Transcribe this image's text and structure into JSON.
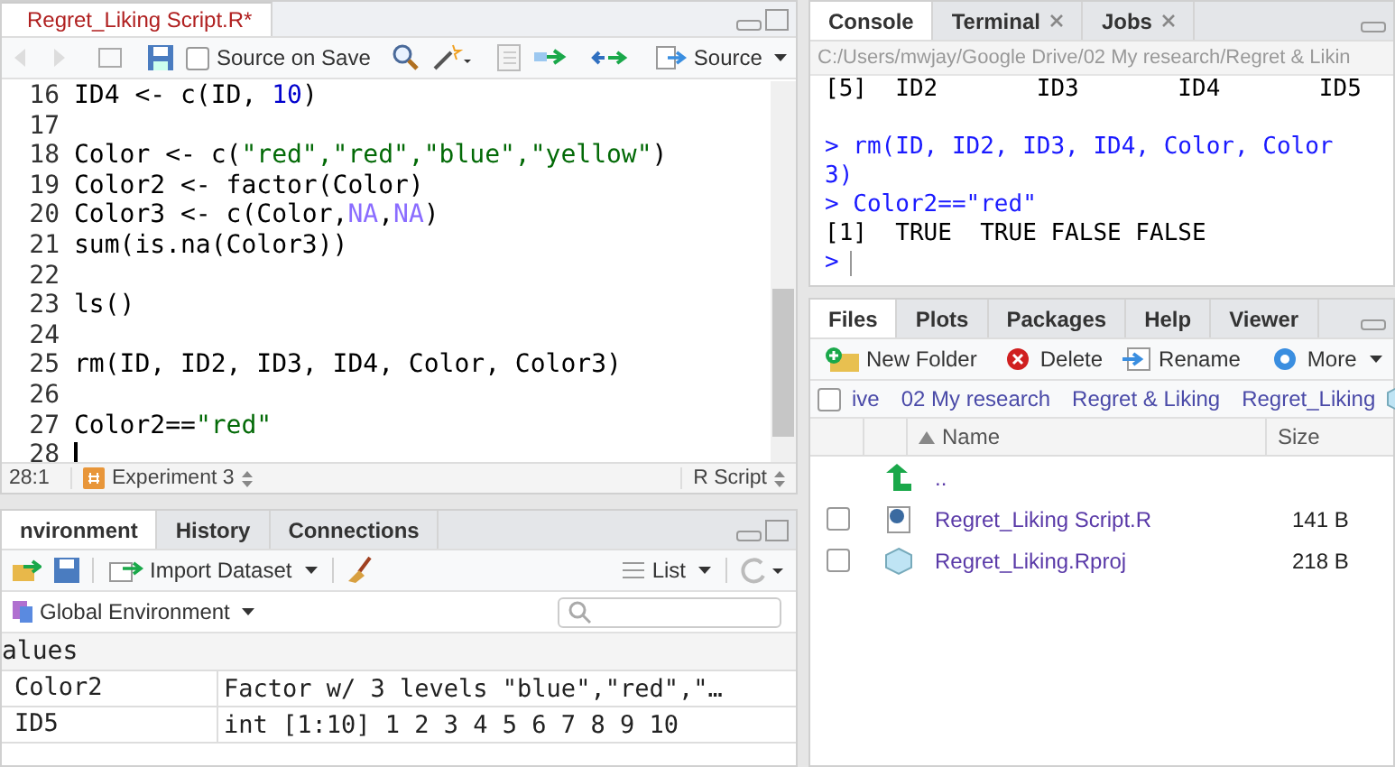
{
  "editor": {
    "tab": {
      "label": "Regret_Liking Script.R*",
      "selected": true
    },
    "toolbar": {
      "source_on_save": {
        "label": "Source on Save",
        "checked": false
      },
      "source_button": "Source"
    },
    "lines": [
      {
        "number": "16",
        "cursor": false,
        "tokens": [
          {
            "text": "ID4 <- c(ID, ",
            "kind": "plain"
          },
          {
            "text": "10",
            "kind": "number"
          },
          {
            "text": ")",
            "kind": "plain"
          }
        ]
      },
      {
        "number": "17",
        "cursor": false
      },
      {
        "number": "18",
        "cursor": false,
        "tokens": [
          {
            "text": "Color <- c(",
            "kind": "plain"
          },
          {
            "text": "\"red\",\"red\",\"blue\",\"yellow\"",
            "kind": "string"
          },
          {
            "text": ")",
            "kind": "plain"
          }
        ]
      },
      {
        "number": "19",
        "cursor": false,
        "tokens": [
          {
            "text": "Color2 <- factor(Color)",
            "kind": "plain"
          }
        ]
      },
      {
        "number": "20",
        "cursor": false,
        "tokens": [
          {
            "text": "Color3 <- c(Color,",
            "kind": "plain"
          },
          {
            "text": "NA",
            "kind": "constant"
          },
          {
            "text": ",",
            "kind": "plain"
          },
          {
            "text": "NA",
            "kind": "constant"
          },
          {
            "text": ")",
            "kind": "plain"
          }
        ]
      },
      {
        "number": "21",
        "cursor": false,
        "tokens": [
          {
            "text": "sum(is.na(Color3))",
            "kind": "plain"
          }
        ]
      },
      {
        "number": "22",
        "cursor": false
      },
      {
        "number": "23",
        "cursor": false,
        "tokens": [
          {
            "text": "ls()",
            "kind": "plain"
          }
        ]
      },
      {
        "number": "24",
        "cursor": false
      },
      {
        "number": "25",
        "cursor": false,
        "tokens": [
          {
            "text": "rm(ID, ID2, ID3, ID4, Color, Color3)",
            "kind": "plain"
          }
        ]
      },
      {
        "number": "26",
        "cursor": false
      },
      {
        "number": "27",
        "cursor": false,
        "tokens": [
          {
            "text": "Color2==",
            "kind": "plain"
          },
          {
            "text": "\"red\"",
            "kind": "string"
          }
        ]
      },
      {
        "number": "28",
        "cursor": true
      }
    ],
    "status": {
      "position": "28:1",
      "section": "Experiment 3",
      "file_type": "R Script"
    }
  },
  "console": {
    "tabs": [
      {
        "label": "Console",
        "selected": true,
        "closable": false
      },
      {
        "label": "Terminal",
        "selected": false,
        "closable": true
      },
      {
        "label": "Jobs",
        "selected": false,
        "closable": true
      }
    ],
    "path": "C:/Users/mwjay/Google Drive/02 My research/Regret & Likin",
    "lines": [
      {
        "kind": "output",
        "text": "[5]  ID2       ID3       ID4       ID5"
      },
      {
        "kind": "blank"
      },
      {
        "kind": "input",
        "text": "> rm(ID, ID2, ID3, ID4, Color, Color"
      },
      {
        "kind": "input",
        "text": "3)"
      },
      {
        "kind": "input",
        "text": "> Color2==\"red\""
      },
      {
        "kind": "output",
        "text": "[1]  TRUE  TRUE FALSE FALSE"
      },
      {
        "kind": "prompt",
        "text": ">"
      }
    ]
  },
  "environment": {
    "tabs": [
      {
        "label": "nvironment",
        "selected": true
      },
      {
        "label": "History",
        "selected": false
      },
      {
        "label": "Connections",
        "selected": false
      }
    ],
    "import_button": "Import Dataset",
    "view_button": "List",
    "scope": "Global Environment",
    "section": "alues",
    "rows": [
      {
        "name": "Color2",
        "value": "Factor w/ 3 levels \"blue\",\"red\",\"…"
      },
      {
        "name": "ID5",
        "value": "int [1:10] 1 2 3 4 5 6 7 8 9 10"
      }
    ]
  },
  "files": {
    "tabs": [
      {
        "label": "Files",
        "selected": true
      },
      {
        "label": "Plots",
        "selected": false
      },
      {
        "label": "Packages",
        "selected": false
      },
      {
        "label": "Help",
        "selected": false
      },
      {
        "label": "Viewer",
        "selected": false
      }
    ],
    "toolbar": [
      "New Folder",
      "Delete",
      "Rename",
      "More"
    ],
    "select_all_checked": false,
    "breadcrumb": [
      "ive",
      "02 My research",
      "Regret & Liking",
      "Regret_Liking"
    ],
    "columns": [
      "Name",
      "Size"
    ],
    "rows": [
      {
        "kind": "parent",
        "name": ".."
      },
      {
        "kind": "r-script",
        "name": "Regret_Liking Script.R",
        "size": "141 B",
        "checked": false
      },
      {
        "kind": "rproj",
        "name": "Regret_Liking.Rproj",
        "size": "218 B",
        "checked": false
      }
    ]
  }
}
